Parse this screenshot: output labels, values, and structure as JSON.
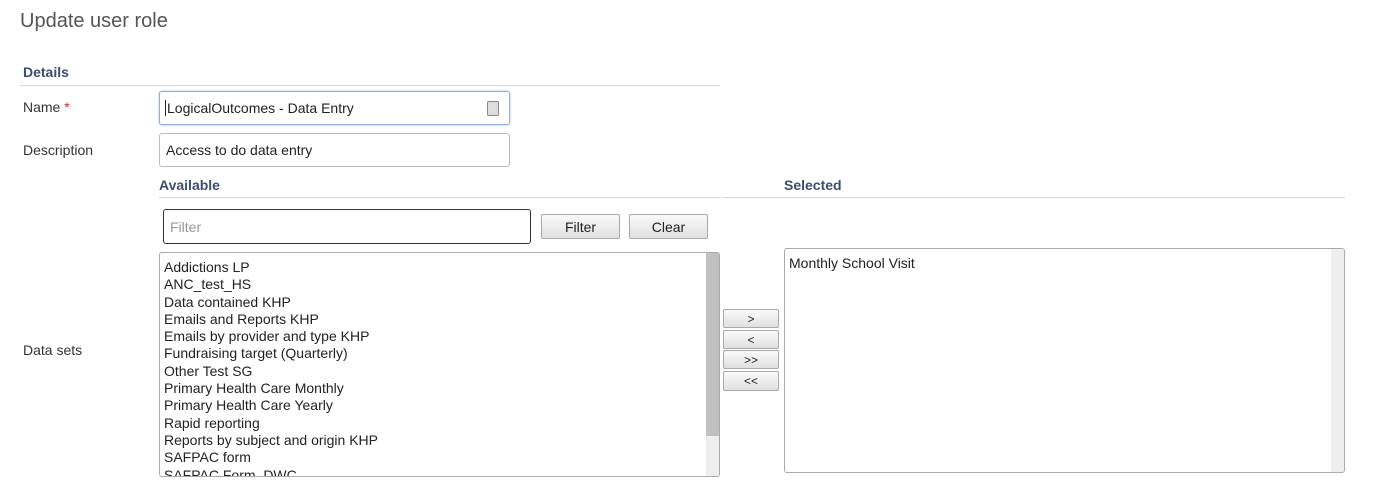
{
  "page_title": "Update user role",
  "details": {
    "header": "Details",
    "name_label": "Name",
    "required_mark": "*",
    "name_value": "LogicalOutcomes - Data Entry",
    "description_label": "Description",
    "description_value": "Access to do data entry"
  },
  "data_sets": {
    "label": "Data sets",
    "available_header": "Available",
    "selected_header": "Selected",
    "filter_placeholder": "Filter",
    "filter_button": "Filter",
    "clear_button": "Clear",
    "available": [
      "Addictions LP",
      "ANC_test_HS",
      "Data contained KHP",
      "Emails and Reports KHP",
      "Emails by provider and type KHP",
      "Fundraising target (Quarterly)",
      "Other Test SG",
      "Primary Health Care Monthly",
      "Primary Health Care Yearly",
      "Rapid reporting",
      "Reports by subject and origin KHP",
      "SAFPAC form",
      "SAFPAC Form_DWC"
    ],
    "selected": [
      "Monthly School Visit"
    ],
    "move_buttons": {
      "add": ">",
      "remove": "<",
      "add_all": ">>",
      "remove_all": "<<"
    }
  }
}
